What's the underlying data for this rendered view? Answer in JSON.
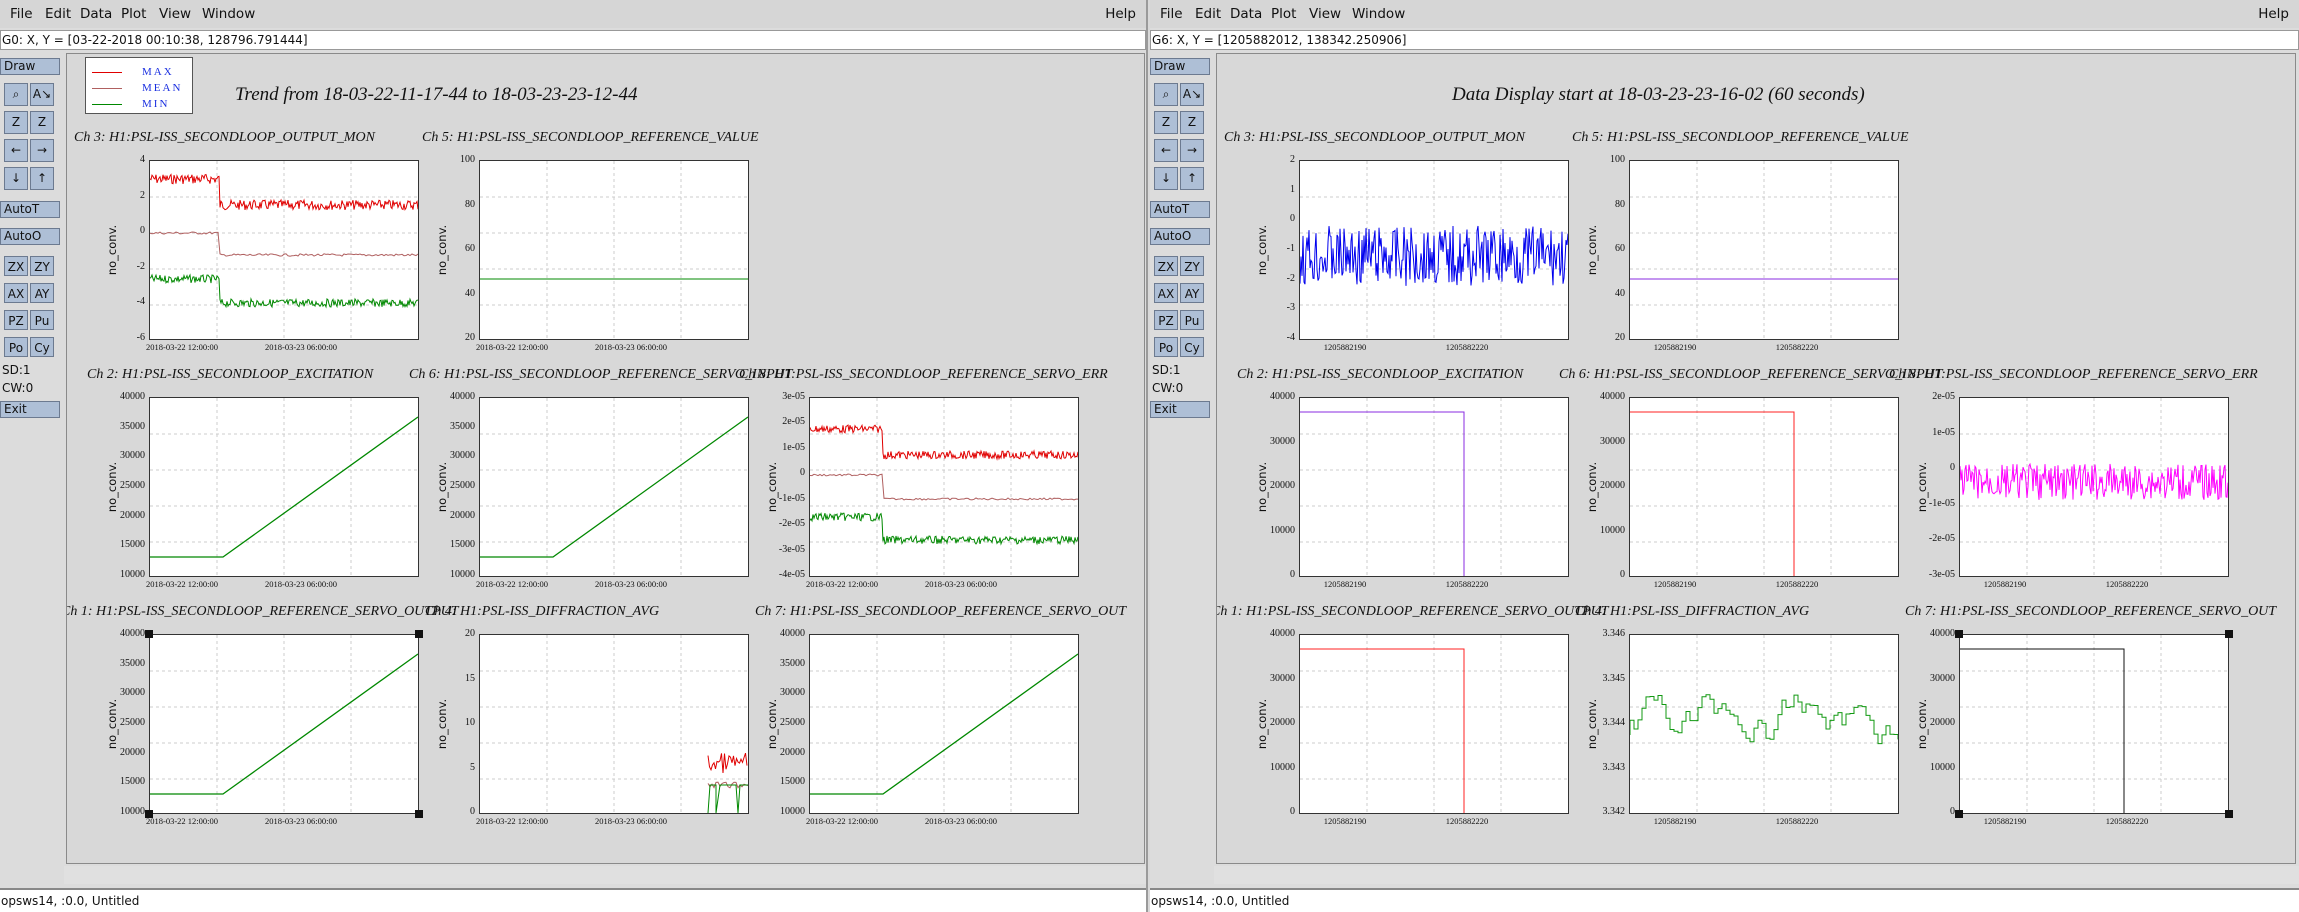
{
  "windows": [
    {
      "id": "L",
      "menu": {
        "file": "File",
        "edit": "Edit",
        "data": "Data",
        "plot": "Plot",
        "view": "View",
        "window": "Window",
        "help": "Help"
      },
      "coord_readout": "G0: X, Y = [03-22-2018 00:10:38, 128796.791444]",
      "title": "Trend from 18-03-22-11-17-44 to 18-03-23-23-12-44",
      "legend": [
        "MAX",
        "MEAN",
        "MIN"
      ],
      "status": "opsws14, :0.0, Untitled",
      "plots": [
        {
          "title": "Ch 3: H1:PSL-ISS_SECONDLOOP_OUTPUT_MON",
          "ylabel": "no_conv.",
          "yticks": [
            "4",
            "2",
            "0",
            "-2",
            "-4",
            "-6"
          ],
          "xticks": [
            "2018-03-22 12:00:00",
            "2018-03-23 06:00:00"
          ]
        },
        {
          "title": "Ch 5: H1:PSL-ISS_SECONDLOOP_REFERENCE_VALUE",
          "ylabel": "no_conv.",
          "yticks": [
            "100",
            "80",
            "60",
            "40",
            "20"
          ],
          "xticks": [
            "2018-03-22 12:00:00",
            "2018-03-23 06:00:00"
          ]
        },
        {
          "title": "Ch 2: H1:PSL-ISS_SECONDLOOP_EXCITATION",
          "ylabel": "no_conv.",
          "yticks": [
            "40000",
            "35000",
            "30000",
            "25000",
            "20000",
            "15000",
            "10000"
          ],
          "xticks": [
            "2018-03-22 12:00:00",
            "2018-03-23 06:00:00"
          ]
        },
        {
          "title": "Ch 6: H1:PSL-ISS_SECONDLOOP_REFERENCE_SERVO_INPUT",
          "ylabel": "no_conv.",
          "yticks": [
            "40000",
            "35000",
            "30000",
            "25000",
            "20000",
            "15000",
            "10000"
          ],
          "xticks": [
            "2018-03-22 12:00:00",
            "2018-03-23 06:00:00"
          ]
        },
        {
          "title": "Ch 8: H1:PSL-ISS_SECONDLOOP_REFERENCE_SERVO_ERR",
          "ylabel": "no_conv.",
          "yticks": [
            "3e-05",
            "2e-05",
            "1e-05",
            "0",
            "-1e-05",
            "-2e-05",
            "-3e-05",
            "-4e-05"
          ],
          "xticks": [
            "2018-03-22 12:00:00",
            "2018-03-23 06:00:00"
          ]
        },
        {
          "title": "Ch 1: H1:PSL-ISS_SECONDLOOP_REFERENCE_SERVO_OUTPUT",
          "ylabel": "no_conv.",
          "yticks": [
            "40000",
            "35000",
            "30000",
            "25000",
            "20000",
            "15000",
            "10000"
          ],
          "xticks": [
            "2018-03-22 12:00:00",
            "2018-03-23 06:00:00"
          ]
        },
        {
          "title": "Ch 4: H1:PSL-ISS_DIFFRACTION_AVG",
          "ylabel": "no_conv.",
          "yticks": [
            "20",
            "15",
            "10",
            "5",
            "0"
          ],
          "xticks": [
            "2018-03-22 12:00:00",
            "2018-03-23 06:00:00"
          ]
        },
        {
          "title": "Ch 7: H1:PSL-ISS_SECONDLOOP_REFERENCE_SERVO_OUT",
          "ylabel": "no_conv.",
          "yticks": [
            "40000",
            "35000",
            "30000",
            "25000",
            "20000",
            "15000",
            "10000"
          ],
          "xticks": [
            "2018-03-22 12:00:00",
            "2018-03-23 06:00:00"
          ]
        }
      ]
    },
    {
      "id": "R",
      "menu": {
        "file": "File",
        "edit": "Edit",
        "data": "Data",
        "plot": "Plot",
        "view": "View",
        "window": "Window",
        "help": "Help"
      },
      "coord_readout": "G6: X, Y = [1205882012, 138342.250906]",
      "title": "Data Display start at 18-03-23-23-16-02 (60 seconds)",
      "status": "opsws14, :0.0, Untitled",
      "plots": [
        {
          "title": "Ch 3: H1:PSL-ISS_SECONDLOOP_OUTPUT_MON",
          "ylabel": "no_conv.",
          "yticks": [
            "2",
            "1",
            "0",
            "-1",
            "-2",
            "-3",
            "-4"
          ],
          "xticks": [
            "1205882190",
            "1205882220"
          ]
        },
        {
          "title": "Ch 5: H1:PSL-ISS_SECONDLOOP_REFERENCE_VALUE",
          "ylabel": "no_conv.",
          "yticks": [
            "100",
            "80",
            "60",
            "40",
            "20"
          ],
          "xticks": [
            "1205882190",
            "1205882220"
          ]
        },
        {
          "title": "Ch 2: H1:PSL-ISS_SECONDLOOP_EXCITATION",
          "ylabel": "no_conv.",
          "yticks": [
            "40000",
            "30000",
            "20000",
            "10000",
            "0"
          ],
          "xticks": [
            "1205882190",
            "1205882220"
          ]
        },
        {
          "title": "Ch 6: H1:PSL-ISS_SECONDLOOP_REFERENCE_SERVO_INPUT",
          "ylabel": "no_conv.",
          "yticks": [
            "40000",
            "30000",
            "20000",
            "10000",
            "0"
          ],
          "xticks": [
            "1205882190",
            "1205882220"
          ]
        },
        {
          "title": "Ch 8: H1:PSL-ISS_SECONDLOOP_REFERENCE_SERVO_ERR",
          "ylabel": "no_conv.",
          "yticks": [
            "2e-05",
            "1e-05",
            "0",
            "-1e-05",
            "-2e-05",
            "-3e-05"
          ],
          "xticks": [
            "1205882190",
            "1205882220"
          ]
        },
        {
          "title": "Ch 1: H1:PSL-ISS_SECONDLOOP_REFERENCE_SERVO_OUTPUT",
          "ylabel": "no_conv.",
          "yticks": [
            "40000",
            "30000",
            "20000",
            "10000",
            "0"
          ],
          "xticks": [
            "1205882190",
            "1205882220"
          ]
        },
        {
          "title": "Ch 4: H1:PSL-ISS_DIFFRACTION_AVG",
          "ylabel": "no_conv.",
          "yticks": [
            "3.346",
            "3.345",
            "3.344",
            "3.343",
            "3.342"
          ],
          "xticks": [
            "1205882190",
            "1205882220"
          ]
        },
        {
          "title": "Ch 7: H1:PSL-ISS_SECONDLOOP_REFERENCE_SERVO_OUT",
          "ylabel": "no_conv.",
          "yticks": [
            "40000",
            "30000",
            "20000",
            "10000",
            "0"
          ],
          "xticks": [
            "1205882190",
            "1205882220"
          ]
        }
      ]
    }
  ],
  "toolbar": {
    "draw": "Draw",
    "autoT": "AutoT",
    "autoO": "AutoO",
    "zoom_in": "Z",
    "zoom_out": "Z",
    "pairs": [
      [
        "ZX",
        "ZY"
      ],
      [
        "AX",
        "AY"
      ],
      [
        "PZ",
        "Pu"
      ],
      [
        "Po",
        "Cy"
      ]
    ],
    "sd": "SD:1",
    "cw": "CW:0",
    "exit": "Exit"
  },
  "colors": {
    "max": "#e00000",
    "mean": "#b06060",
    "min": "#008800",
    "trace_blue": "#0000ee",
    "trace_purple": "#8a2be2",
    "trace_magenta": "#ff00ff",
    "trace_red": "#ff2020",
    "trace_green": "#119911",
    "trace_black": "#111111"
  }
}
